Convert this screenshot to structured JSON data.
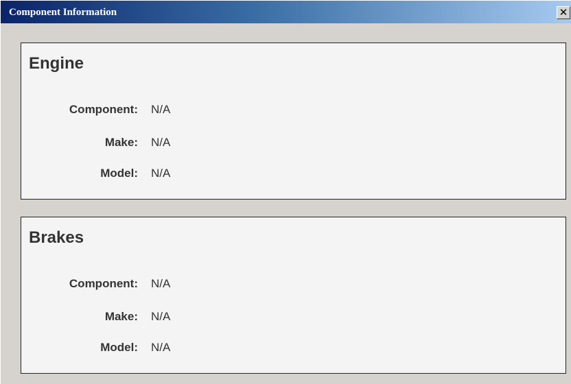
{
  "window": {
    "title": "Component Information",
    "close_symbol": "✕",
    "close_icon": "close-icon"
  },
  "sections": [
    {
      "title": "Engine",
      "fields": [
        {
          "label": "Component:",
          "value": "N/A"
        },
        {
          "label": "Make:",
          "value": "N/A"
        },
        {
          "label": "Model:",
          "value": "N/A"
        }
      ]
    },
    {
      "title": "Brakes",
      "fields": [
        {
          "label": "Component:",
          "value": "N/A"
        },
        {
          "label": "Make:",
          "value": "N/A"
        },
        {
          "label": "Model:",
          "value": "N/A"
        }
      ]
    }
  ],
  "colors": {
    "titlebar_start": "#0a246a",
    "titlebar_end": "#a6caf0",
    "window_background": "#d6d3ce",
    "panel_background": "#f4f4f4",
    "text": "#333333"
  }
}
